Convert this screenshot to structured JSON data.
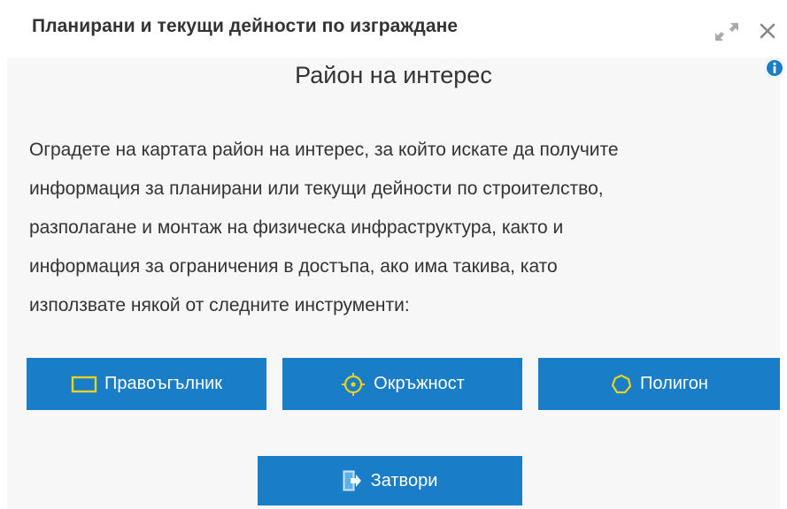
{
  "window": {
    "title": "Планирани и текущи дейности по изграждане",
    "expand_icon": "expand-arrows-icon",
    "close_icon": "close-x-icon",
    "info_icon": "info-icon"
  },
  "panel": {
    "heading": "Район на интерес",
    "description_lines": [
      "Оградете на картата район на интерес, за който искате да получите",
      "информация за планирани или текущи дейности по строителство,",
      "разполагане и монтаж на физическа инфраструктура, както и",
      "информация за ограничения в достъпа, ако има такива, като",
      "използвате някой от следните инструменти:"
    ]
  },
  "tools": {
    "rectangle_label": "Правоъгълник",
    "circle_label": "Окръжност",
    "polygon_label": "Полигон"
  },
  "actions": {
    "close_label": "Затвори"
  },
  "colors": {
    "button_blue": "#1a7dc8",
    "icon_yellow": "#e8d31e",
    "text": "#333333",
    "content_bg": "#f7f7f7"
  }
}
